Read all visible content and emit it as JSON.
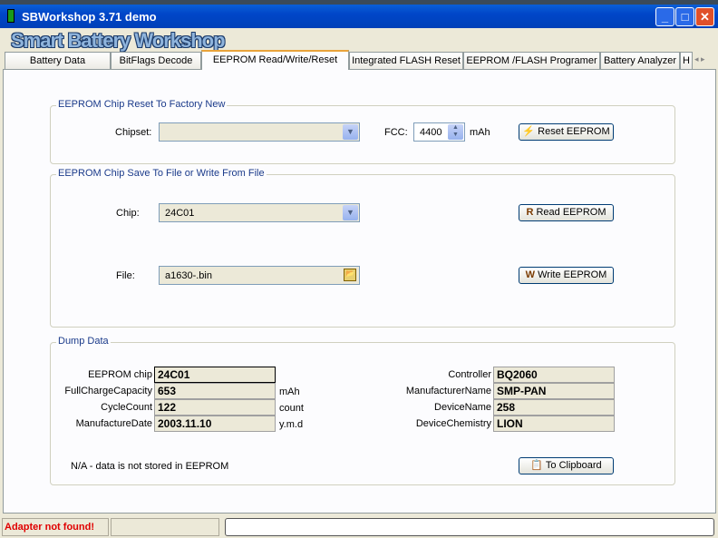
{
  "window": {
    "title": "SBWorkshop 3.71 demo",
    "logo": "Smart Battery Workshop"
  },
  "tabs": [
    "Battery Data",
    "BitFlags Decode",
    "EEPROM Read/Write/Reset",
    "Integrated FLASH Reset",
    "EEPROM /FLASH Programer",
    "Battery Analyzer",
    "H"
  ],
  "active_tab": "EEPROM Read/Write/Reset",
  "reset_group": {
    "title": "EEPROM Chip Reset To Factory New",
    "chipset_label": "Chipset:",
    "chipset_value": "",
    "fcc_label": "FCC:",
    "fcc_value": "4400",
    "fcc_unit": "mAh",
    "reset_button": "Reset EEPROM"
  },
  "file_group": {
    "title": "EEPROM Chip Save To File or Write From File",
    "chip_label": "Chip:",
    "chip_value": "24C01",
    "read_button": "Read EEPROM",
    "file_label": "File:",
    "file_value": "a1630-.bin",
    "write_button": "Write EEPROM"
  },
  "dump": {
    "title": "Dump Data",
    "left": [
      {
        "label": "EEPROM chip",
        "value": "24C01",
        "unit": ""
      },
      {
        "label": "FullChargeCapacity",
        "value": "653",
        "unit": "mAh"
      },
      {
        "label": "CycleCount",
        "value": "122",
        "unit": "count"
      },
      {
        "label": "ManufactureDate",
        "value": "2003.11.10",
        "unit": "y.m.d"
      }
    ],
    "right": [
      {
        "label": "Controller",
        "value": "BQ2060"
      },
      {
        "label": "ManufacturerName",
        "value": "SMP-PAN"
      },
      {
        "label": "DeviceName",
        "value": "258"
      },
      {
        "label": "DeviceChemistry",
        "value": "LION"
      }
    ],
    "note": "N/A - data is not stored in EEPROM",
    "clipboard_button": "To Clipboard"
  },
  "status": {
    "message": "Adapter not found!",
    "message_color": "#e00000"
  }
}
